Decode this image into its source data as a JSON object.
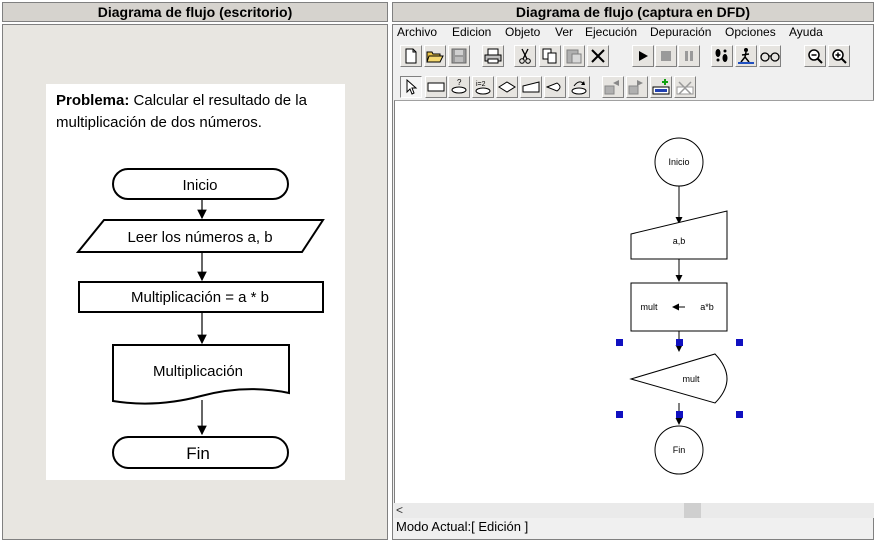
{
  "left_panel": {
    "title": "Diagrama de flujo (escritorio)",
    "problem_label": "Problema:",
    "problem_text_line1": " Calcular el resultado de la",
    "problem_text_line2": "multiplicación de dos números.",
    "flow": {
      "start": "Inicio",
      "input": "Leer los números  a, b",
      "process": "Multiplicación = a * b",
      "output": "Multiplicación",
      "end": "Fin"
    }
  },
  "right_panel": {
    "title": "Diagrama de flujo (captura en DFD)",
    "menu": [
      "Archivo",
      "Edicion",
      "Objeto",
      "Ver",
      "Ejecución",
      "Depuración",
      "Opciones",
      "Ayuda"
    ],
    "toolbar_icons_row1": [
      "new-file-icon",
      "open-folder-icon",
      "save-icon",
      "print-icon",
      "cut-icon",
      "copy-icon",
      "paste-icon",
      "delete-icon",
      "run-icon",
      "stop-icon",
      "pause-icon",
      "step-icon",
      "run-to-cursor-icon",
      "watch-icon",
      "zoom-out-icon",
      "zoom-in-icon"
    ],
    "toolbar_icons_row2": [
      "pointer-icon",
      "assignment-icon",
      "cycle-icon",
      "for-loop-icon",
      "decision-icon",
      "read-icon",
      "write-icon",
      "subprogram-icon",
      "step-back-icon",
      "step-forward-icon",
      "add-watch-icon",
      "remove-watch-icon"
    ],
    "flow": {
      "start": "Inicio",
      "read": "a,b",
      "assign_var": "mult",
      "assign_expr": "a*b",
      "write": "mult",
      "end": "Fin"
    },
    "scroll_arrow": "<",
    "status": "Modo Actual:[ Edición ]"
  }
}
